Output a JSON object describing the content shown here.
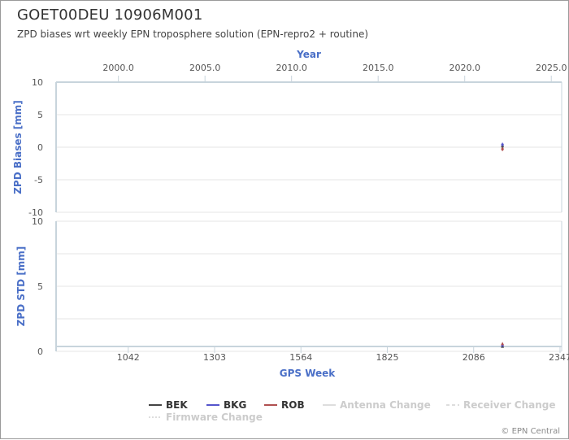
{
  "header": {
    "title": "GOET00DEU 10906M001",
    "subtitle": "ZPD biases wrt weekly EPN troposphere solution (EPN-repro2 + routine)"
  },
  "credits": "© EPN Central",
  "colors": {
    "axis_title": "#4a6fc7",
    "BEK": "#444444",
    "BKG": "#5555cc",
    "ROB": "#b05050",
    "grid": "#e4e4e4",
    "axis_line": "#c8d4dc",
    "disabled": "#cccccc"
  },
  "chart_data": [
    {
      "type": "scatter",
      "title": "",
      "ylabel": "ZPD Biases [mm]",
      "ylim": [
        -10,
        10
      ],
      "y_ticks": [
        "10",
        "5",
        "0",
        "-5",
        "-10"
      ],
      "top_axis": {
        "label": "Year",
        "range": [
          1996.4,
          2025.6
        ],
        "ticks": [
          "2000.0",
          "2005.0",
          "2010.0",
          "2015.0",
          "2020.0",
          "2025.0"
        ]
      },
      "grid": true,
      "series": [
        {
          "name": "BEK",
          "x": [
            2173
          ],
          "y": [
            0.1
          ],
          "err": [
            0.3
          ]
        },
        {
          "name": "BKG",
          "x": [
            2173
          ],
          "y": [
            0.4
          ],
          "err": [
            0.3
          ]
        },
        {
          "name": "ROB",
          "x": [
            2173
          ],
          "y": [
            -0.3
          ],
          "err": [
            0.3
          ]
        }
      ]
    },
    {
      "type": "scatter",
      "title": "",
      "ylabel": "ZPD STD [mm]",
      "xlabel": "GPS Week",
      "ylim": [
        0,
        10
      ],
      "y_ticks": [
        "10",
        "5",
        "0"
      ],
      "xlim": [
        824,
        2352
      ],
      "x_ticks": [
        "1042",
        "1303",
        "1564",
        "1825",
        "2086",
        "2347"
      ],
      "grid": true,
      "series": [
        {
          "name": "BEK",
          "x": [
            2173
          ],
          "y": [
            0.4
          ]
        },
        {
          "name": "BKG",
          "x": [
            2173
          ],
          "y": [
            0.5
          ]
        },
        {
          "name": "ROB",
          "x": [
            2173
          ],
          "y": [
            0.6
          ]
        }
      ]
    }
  ],
  "legend": {
    "placement": "bottom-center",
    "items": [
      {
        "label": "BEK",
        "color": "#444444",
        "style": "solid",
        "enabled": true
      },
      {
        "label": "BKG",
        "color": "#5555cc",
        "style": "solid",
        "enabled": true
      },
      {
        "label": "ROB",
        "color": "#b05050",
        "style": "solid",
        "enabled": true
      },
      {
        "label": "Antenna Change",
        "color": "#dddddd",
        "style": "solid",
        "enabled": false
      },
      {
        "label": "Receiver Change",
        "color": "#dddddd",
        "style": "dashed",
        "enabled": false
      },
      {
        "label": "Firmware Change",
        "color": "#dddddd",
        "style": "dotted",
        "enabled": false
      }
    ]
  }
}
